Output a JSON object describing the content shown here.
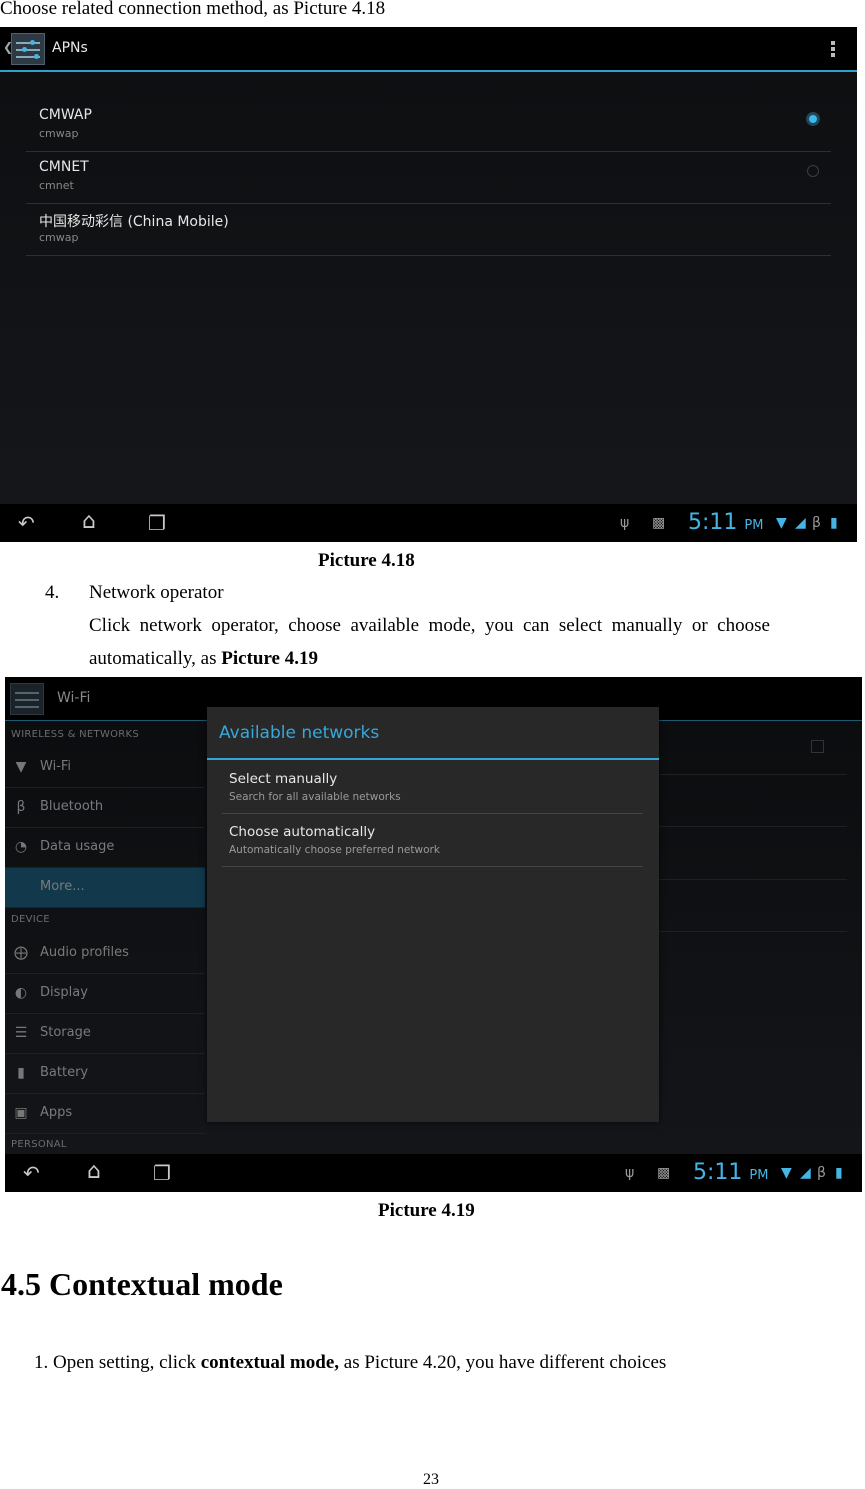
{
  "intro_text": "Choose related connection method, as Picture 4.18",
  "picture_4_18": {
    "caption": "Picture 4.18",
    "action_bar": {
      "title": "APNs",
      "icon": "settings-sliders-icon",
      "menu_icon": "overflow-menu-icon"
    },
    "apns": [
      {
        "name": "CMWAP",
        "apn": "cmwap",
        "selected": true
      },
      {
        "name": "CMNET",
        "apn": "cmnet",
        "selected": false
      },
      {
        "name": "中国移动彩信 (China Mobile)",
        "apn": "cmwap",
        "selected": null
      }
    ],
    "status_bar": {
      "time": "5:11",
      "ampm": "PM",
      "icons": [
        "usb-icon",
        "android-icon",
        "wifi-icon",
        "signal-icon",
        "bluetooth-icon",
        "battery-charging-icon"
      ]
    },
    "nav_buttons": [
      "back-icon",
      "home-icon",
      "recent-apps-icon"
    ]
  },
  "step4": {
    "number": "4.",
    "title": "Network operator",
    "body_line1": "Click  network  operator,  choose  available  mode,  you  can  select  manually  or  choose",
    "body_line2_prefix": "automatically, as ",
    "body_line2_bold": "Picture 4.19"
  },
  "picture_4_19": {
    "caption": "Picture 4.19",
    "action_bar": {
      "title": "Wi-Fi"
    },
    "sidebar": {
      "sections": [
        {
          "header": "WIRELESS & NETWORKS",
          "items": [
            {
              "label": "Wi-Fi",
              "icon": "wifi-icon"
            },
            {
              "label": "Bluetooth",
              "icon": "bluetooth-icon"
            },
            {
              "label": "Data usage",
              "icon": "data-usage-icon"
            },
            {
              "label": "More...",
              "icon": "",
              "active": true
            }
          ]
        },
        {
          "header": "DEVICE",
          "items": [
            {
              "label": "Audio profiles",
              "icon": "audio-profiles-icon"
            },
            {
              "label": "Display",
              "icon": "display-icon"
            },
            {
              "label": "Storage",
              "icon": "storage-icon"
            },
            {
              "label": "Battery",
              "icon": "battery-icon"
            },
            {
              "label": "Apps",
              "icon": "apps-icon"
            }
          ]
        },
        {
          "header": "PERSONAL",
          "items": []
        }
      ]
    },
    "dialog": {
      "title": "Available networks",
      "options": [
        {
          "title": "Select manually",
          "subtitle": "Search for all available networks"
        },
        {
          "title": "Choose automatically",
          "subtitle": "Automatically choose preferred network"
        }
      ]
    },
    "status_bar": {
      "time": "5:11",
      "ampm": "PM"
    }
  },
  "section": {
    "heading": "4.5 Contextual mode"
  },
  "step1": {
    "prefix": "1. Open setting, click ",
    "bold": "contextual mode,",
    "suffix": " as Picture 4.20, you have different choices"
  },
  "page_number": "23",
  "colors": {
    "accent": "#33a6d8",
    "time": "#45b5e6",
    "selected_item": "#11384b"
  }
}
